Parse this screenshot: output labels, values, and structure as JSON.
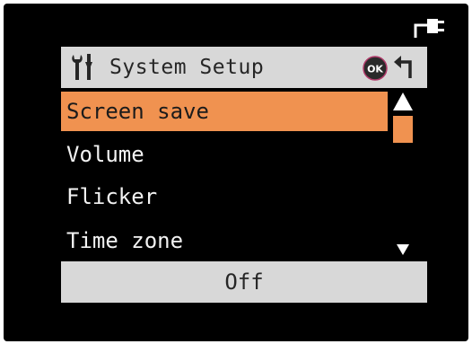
{
  "header": {
    "title": "System Setup",
    "icon": "tools-icon",
    "ok_icon": "ok-icon",
    "ok_label": "OK",
    "back_icon": "back-arrow-icon"
  },
  "status": {
    "power_icon": "power-plug-icon"
  },
  "menu": {
    "items": [
      {
        "label": "Screen save",
        "selected": true
      },
      {
        "label": "Volume",
        "selected": false
      },
      {
        "label": "Flicker",
        "selected": false
      },
      {
        "label": "Time zone",
        "selected": false
      }
    ]
  },
  "scroll": {
    "up_icon": "scroll-up-arrow-icon",
    "down_icon": "scroll-down-arrow-icon"
  },
  "value": {
    "current": "Off"
  },
  "colors": {
    "screen_bg": "#000000",
    "highlight": "#f09250",
    "bar_bg": "#d8d8d8",
    "text": "#f2f2f2"
  }
}
